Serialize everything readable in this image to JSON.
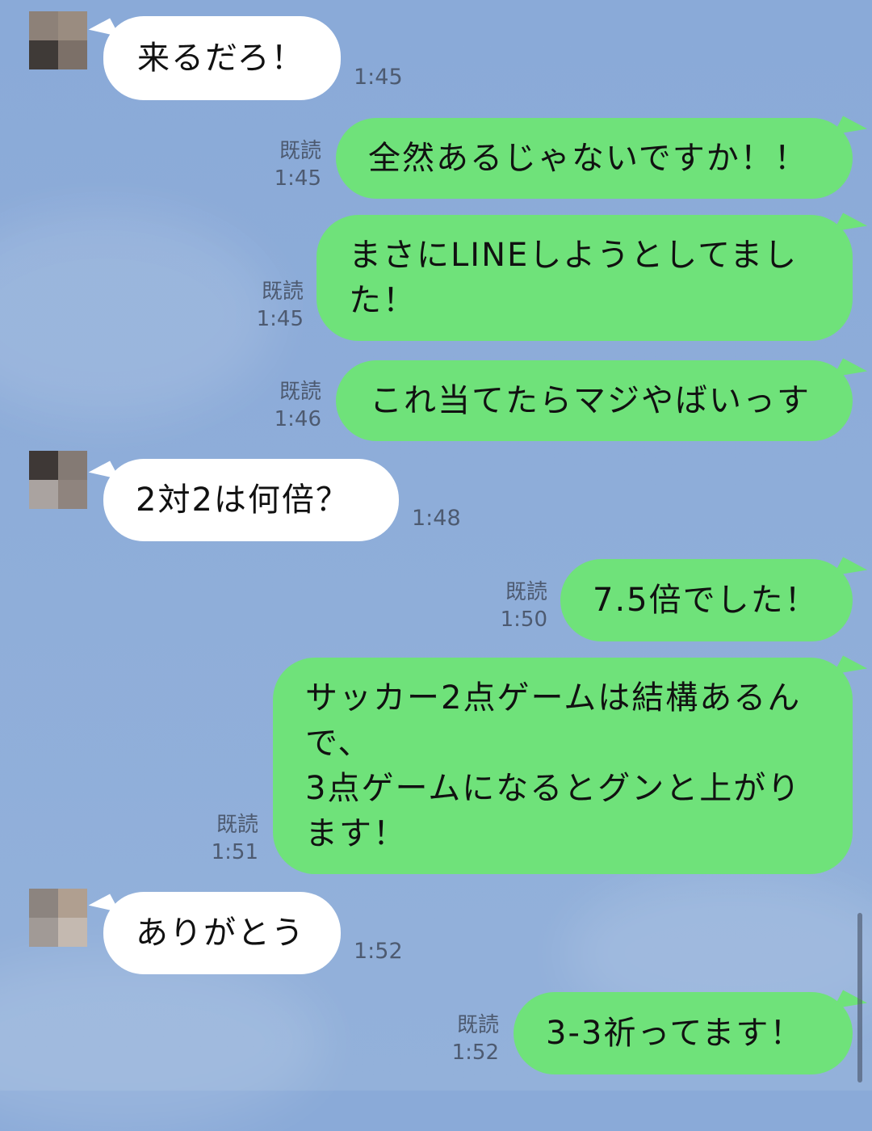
{
  "messages": [
    {
      "side": "in",
      "text": "来るだろ！",
      "time": "1:45"
    },
    {
      "side": "out",
      "read": "既読",
      "time": "1:45",
      "text": "全然あるじゃないですか！！"
    },
    {
      "side": "out",
      "read": "既読",
      "time": "1:45",
      "text": "まさにLINEしようとしてまし\nた！"
    },
    {
      "side": "out",
      "read": "既読",
      "time": "1:46",
      "text": "これ当てたらマジやばいっす"
    },
    {
      "side": "in",
      "text": "2対2は何倍？",
      "time": "1:48"
    },
    {
      "side": "out",
      "read": "既読",
      "time": "1:50",
      "text": "7.5倍でした！"
    },
    {
      "side": "out",
      "read": "既読",
      "time": "1:51",
      "text": "サッカー2点ゲームは結構あるん\nで、\n3点ゲームになるとグンと上がり\nます！"
    },
    {
      "side": "in",
      "text": "ありがとう",
      "time": "1:52"
    },
    {
      "side": "out",
      "read": "既読",
      "time": "1:52",
      "text": "3-3祈ってます！"
    }
  ],
  "colors": {
    "background": "#8eadd9",
    "outgoing": "#6fe27a",
    "incoming": "#ffffff"
  },
  "avatar_icon": "blurred-avatar-icon"
}
